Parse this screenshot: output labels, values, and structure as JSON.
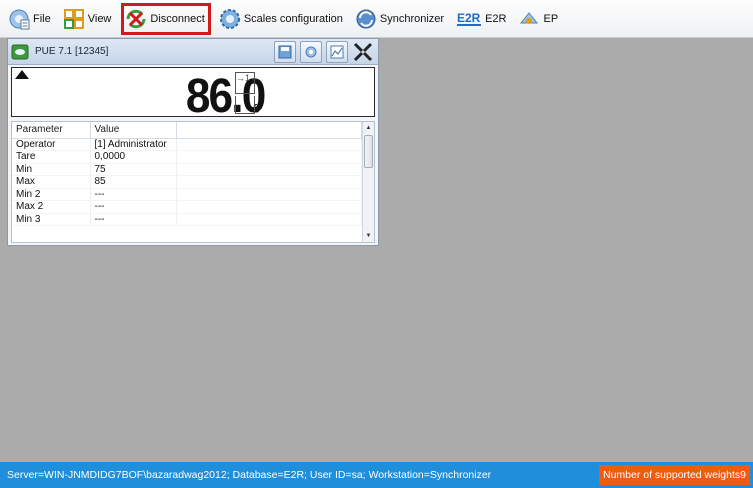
{
  "toolbar": {
    "items": [
      {
        "label": "File",
        "icon": "file-icon"
      },
      {
        "label": "View",
        "icon": "view-icon"
      },
      {
        "label": "Disconnect",
        "icon": "disconnect-icon",
        "highlighted": true
      },
      {
        "label": "Scales configuration",
        "icon": "scales-configuration-icon"
      },
      {
        "label": "Synchronizer",
        "icon": "synchronizer-icon"
      },
      {
        "label": "E2R",
        "icon": "e2r-icon",
        "icon_text": "E2R"
      },
      {
        "label": "EP",
        "icon": "ep-icon"
      }
    ],
    "highlight_color": "#d11a1a"
  },
  "panel": {
    "title": "PUE 7.1 [12345]",
    "buttons": [
      "save-icon",
      "config-icon",
      "chart-icon",
      "collapse-icon"
    ],
    "display": {
      "weight": "86.0",
      "unit": "g",
      "indicator": "→1←"
    },
    "table": {
      "headers": [
        "Parameter",
        "Value"
      ],
      "rows": [
        {
          "parameter": "Operator",
          "value": "[1] Administrator"
        },
        {
          "parameter": "Tare",
          "value": "0,0000"
        },
        {
          "parameter": "Min",
          "value": "75"
        },
        {
          "parameter": "Max",
          "value": "85"
        },
        {
          "parameter": "Min 2",
          "value": "---"
        },
        {
          "parameter": "Max 2",
          "value": "---"
        },
        {
          "parameter": "Min 3",
          "value": "---"
        }
      ]
    }
  },
  "statusbar": {
    "text": "Server=WIN-JNMDIDG7BOF\\bazaradwag2012; Database=E2R; User ID=sa; Workstation=Synchronizer",
    "badge": "Number of supported weights9",
    "color": "#1f8fdc",
    "badge_color": "#f05a12"
  }
}
